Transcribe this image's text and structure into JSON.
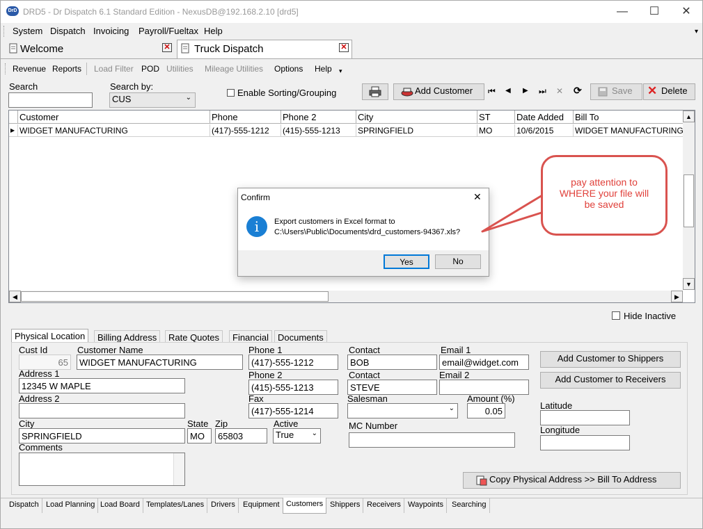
{
  "window": {
    "title": "DRD5 - Dr Dispatch 6.1 Standard Edition - NexusDB@192.168.2.10 [drd5]",
    "app_icon": "DrD",
    "minimize": "—",
    "maximize": "☐",
    "close": "✕"
  },
  "menu": [
    "System",
    "Dispatch",
    "Invoicing",
    "Payroll/Fueltax",
    "Help"
  ],
  "menu_overflow": "▾",
  "doc_tabs": [
    {
      "label": "Welcome",
      "close": "✕"
    },
    {
      "label": "Truck Dispatch",
      "close": "✕"
    }
  ],
  "toolbar": {
    "items": [
      "Revenue",
      "Reports",
      "Load Filter",
      "POD",
      "Utilities",
      "Mileage Utilities",
      "Options",
      "Help"
    ],
    "overflow": "▾"
  },
  "search": {
    "label": "Search",
    "value": "",
    "by_label": "Search by:",
    "by_value": "CUS",
    "sorting_label": "Enable Sorting/Grouping",
    "print_icon": "print-icon",
    "add_customer": "Add Customer",
    "save": "Save",
    "delete": "Delete",
    "nav": [
      "⏮",
      "◀",
      "▶",
      "⏭",
      "✕",
      "⟳"
    ]
  },
  "grid": {
    "columns": [
      "Customer",
      "Phone",
      "Phone 2",
      "City",
      "ST",
      "Date Added",
      "Bill To"
    ],
    "rows": [
      [
        "WIDGET MANUFACTURING",
        "(417)-555-1212",
        "(415)-555-1213",
        "SPRINGFIELD",
        "MO",
        "10/6/2015",
        "WIDGET MANUFACTURING"
      ]
    ],
    "row_indicator": "▶",
    "scroll_up": "▲",
    "scroll_down": "▼",
    "scroll_left": "◀",
    "scroll_right": "▶"
  },
  "hide_inactive": "Hide Inactive",
  "detail_tabs": [
    "Physical Location",
    "Billing Address",
    "Rate Quotes",
    "Financial",
    "Documents"
  ],
  "detail": {
    "cust_id_label": "Cust Id",
    "cust_id": "65",
    "name_label": "Customer Name",
    "name": "WIDGET MANUFACTURING",
    "address1_label": "Address 1",
    "address1": "12345 W MAPLE",
    "address2_label": "Address 2",
    "address2": "",
    "city_label": "City",
    "city": "SPRINGFIELD",
    "state_label": "State",
    "state": "MO",
    "zip_label": "Zip",
    "zip": "65803",
    "active_label": "Active",
    "active": "True",
    "comments_label": "Comments",
    "phone1_label": "Phone 1",
    "phone1": "(417)-555-1212",
    "phone2_label": "Phone 2",
    "phone2": "(415)-555-1213",
    "fax_label": "Fax",
    "fax": "(417)-555-1214",
    "contact1_label": "Contact",
    "contact1": "BOB",
    "contact2_label": "Contact",
    "contact2": "STEVE",
    "salesman_label": "Salesman",
    "salesman": "",
    "mc_label": "MC Number",
    "mc": "",
    "email1_label": "Email 1",
    "email1": "email@widget.com",
    "email2_label": "Email 2",
    "email2": "",
    "amount_label": "Amount (%)",
    "amount": "0.05",
    "lat_label": "Latitude",
    "lat": "",
    "lon_label": "Longitude",
    "lon": "",
    "add_shippers": "Add Customer to Shippers",
    "add_receivers": "Add Customer to Receivers",
    "copy_address": "Copy Physical Address >> Bill To Address"
  },
  "bottom_tabs": [
    "Dispatch",
    "Load Planning",
    "Load Board",
    "Templates/Lanes",
    "Drivers",
    "Equipment",
    "Customers",
    "Shippers",
    "Receivers",
    "Waypoints",
    "Searching"
  ],
  "dialog": {
    "title": "Confirm",
    "icon": "i",
    "message_line1": "Export customers in Excel format to",
    "message_line2": "C:\\Users\\Public\\Documents\\drd_customers-94367.xls?",
    "yes": "Yes",
    "no": "No",
    "close": "✕"
  },
  "callout": {
    "line1": "pay attention to",
    "line2": "WHERE your file will",
    "line3": "be saved"
  },
  "colors": {
    "callout_red": "#d9534f",
    "info_blue": "#1a7fd4"
  }
}
